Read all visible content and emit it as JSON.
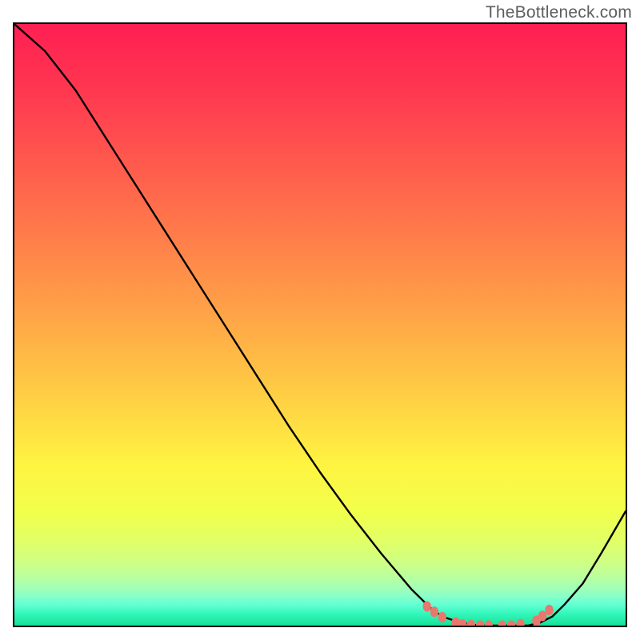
{
  "watermark": "TheBottleneck.com",
  "chart_data": {
    "type": "line",
    "title": "",
    "xlabel": "",
    "ylabel": "",
    "xlim": [
      0,
      100
    ],
    "ylim": [
      0,
      100
    ],
    "description": "Bottleneck percentage curve over a rainbow gradient background (red = high bottleneck, green = optimal). Minimum appears in the 68–86% x-range; a cluster of salmon marker points lies along the flat bottom of the curve.",
    "series": [
      {
        "name": "bottleneck-curve",
        "color": "#000000",
        "x": [
          0,
          5,
          10,
          15,
          20,
          25,
          30,
          35,
          40,
          45,
          50,
          55,
          60,
          65,
          68,
          70,
          73,
          76,
          80,
          84,
          86,
          88,
          90,
          93,
          96,
          100
        ],
        "y": [
          100,
          95.5,
          89,
          81,
          73,
          65,
          57,
          49,
          41,
          33,
          25.5,
          18.5,
          12,
          6,
          3,
          1.5,
          0.5,
          0,
          0,
          0,
          0.5,
          1.5,
          3.5,
          7,
          12,
          19
        ]
      }
    ],
    "markers": {
      "name": "highlight-points",
      "color": "#e9776e",
      "points": [
        {
          "x": 67.5,
          "y": 3.2
        },
        {
          "x": 68.7,
          "y": 2.3
        },
        {
          "x": 70.0,
          "y": 1.4
        },
        {
          "x": 72.2,
          "y": 0.5
        },
        {
          "x": 73.3,
          "y": 0.2
        },
        {
          "x": 74.7,
          "y": 0.1
        },
        {
          "x": 76.2,
          "y": 0.0
        },
        {
          "x": 77.6,
          "y": 0.0
        },
        {
          "x": 79.8,
          "y": 0.0
        },
        {
          "x": 81.3,
          "y": 0.0
        },
        {
          "x": 82.8,
          "y": 0.2
        },
        {
          "x": 85.4,
          "y": 0.8
        },
        {
          "x": 86.4,
          "y": 1.6
        },
        {
          "x": 87.5,
          "y": 2.6
        }
      ]
    },
    "gradient_stops": [
      {
        "pos": 0.0,
        "color": "#ff1f52"
      },
      {
        "pos": 0.11,
        "color": "#ff3750"
      },
      {
        "pos": 0.24,
        "color": "#ff5c4d"
      },
      {
        "pos": 0.37,
        "color": "#ff824a"
      },
      {
        "pos": 0.5,
        "color": "#ffa947"
      },
      {
        "pos": 0.62,
        "color": "#ffcf44"
      },
      {
        "pos": 0.73,
        "color": "#fff341"
      },
      {
        "pos": 0.81,
        "color": "#f2ff4b"
      },
      {
        "pos": 0.86,
        "color": "#e1ff66"
      },
      {
        "pos": 0.89,
        "color": "#d1ff80"
      },
      {
        "pos": 0.915,
        "color": "#beff99"
      },
      {
        "pos": 0.935,
        "color": "#a6ffb4"
      },
      {
        "pos": 0.952,
        "color": "#86ffca"
      },
      {
        "pos": 0.966,
        "color": "#60ffd4"
      },
      {
        "pos": 0.98,
        "color": "#34f7bb"
      },
      {
        "pos": 1.0,
        "color": "#16e197"
      }
    ]
  }
}
